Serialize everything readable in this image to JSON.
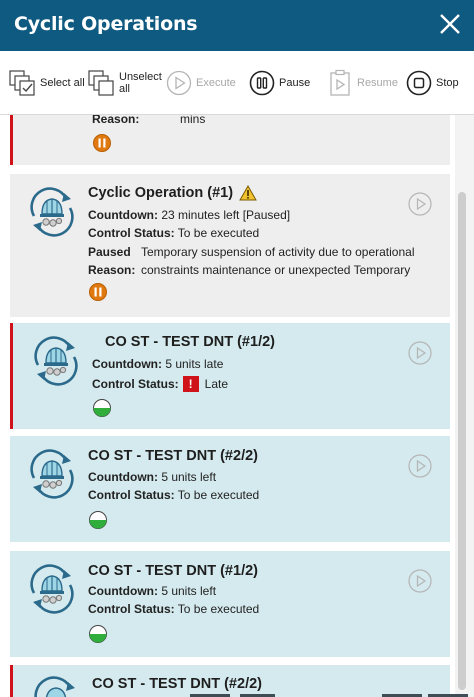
{
  "window": {
    "title": "Cyclic Operations"
  },
  "toolbar": {
    "select_all": "Select all",
    "unselect_all_1": "Unselect",
    "unselect_all_2": "all",
    "execute": "Execute",
    "pause": "Pause",
    "resume": "Resume",
    "stop": "Stop"
  },
  "cards": [
    {
      "partial_label": "Reason:",
      "partial_value": "mins"
    },
    {
      "title": "Cyclic Operation (#1)",
      "countdown_label": "Countdown:",
      "countdown_value": "23 minutes left [Paused]",
      "control_label": "Control Status:",
      "control_value": "To be executed",
      "paused_label": "Paused",
      "reason_label": "Reason:",
      "reason_line1": "Temporary suspension of activity due to operational",
      "reason_line2": "constraints maintenance or unexpected Temporary"
    },
    {
      "title": "CO ST - TEST DNT (#1/2)",
      "countdown_label": "Countdown:",
      "countdown_value": "5 units late",
      "control_label": "Control Status:",
      "control_value": "Late",
      "alert_mark": "!"
    },
    {
      "title": "CO ST - TEST DNT (#2/2)",
      "countdown_label": "Countdown:",
      "countdown_value": "5 units left",
      "control_label": "Control Status:",
      "control_value": "To be executed"
    },
    {
      "title": "CO ST - TEST DNT (#1/2)",
      "countdown_label": "Countdown:",
      "countdown_value": "5 units left",
      "control_label": "Control Status:",
      "control_value": "To be executed"
    },
    {
      "title": "CO ST - TEST DNT (#2/2)"
    }
  ],
  "colors": {
    "header": "#0f5a80",
    "alert_red": "#d0121b",
    "paused_orange": "#e07a10",
    "status_green": "#2fae3c",
    "card_grey": "#eeeeee",
    "card_blue": "#d4eaee",
    "warning_yellow": "#f2c12e"
  },
  "icons": [
    "close-icon",
    "select-all-icon",
    "unselect-all-icon",
    "execute-icon",
    "pause-icon",
    "resume-icon",
    "stop-icon",
    "cyclic-operation-icon",
    "play-icon",
    "paused-status-icon",
    "warning-icon",
    "status-half-green-icon",
    "alert-icon"
  ]
}
